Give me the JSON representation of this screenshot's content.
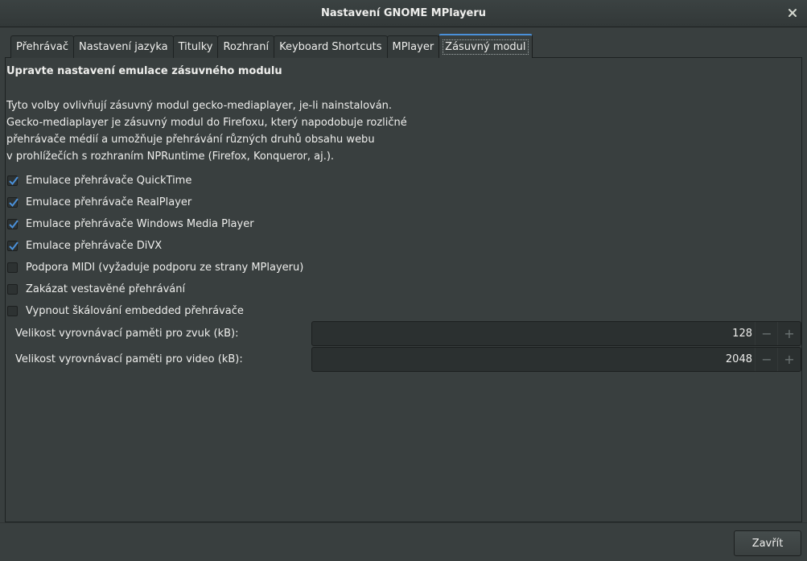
{
  "window": {
    "title": "Nastavení GNOME MPlayeru"
  },
  "tabs": [
    {
      "label": "Přehrávač"
    },
    {
      "label": "Nastavení jazyka"
    },
    {
      "label": "Titulky"
    },
    {
      "label": "Rozhraní"
    },
    {
      "label": "Keyboard Shortcuts"
    },
    {
      "label": "MPlayer"
    },
    {
      "label": "Zásuvný modul",
      "active": true
    }
  ],
  "panel": {
    "heading": "Upravte nastavení emulace zásuvného modulu",
    "description": "Tyto volby ovlivňují zásuvný modul gecko-mediaplayer, je-li nainstalován.\nGecko-mediaplayer je zásuvný modul do Firefoxu, který napodobuje rozličné\npřehrávače médií a umožňuje přehrávání různých druhů obsahu webu\nv prohlížečích s rozhraním NPRuntime (Firefox, Konqueror, aj.).",
    "checkboxes": [
      {
        "label": "Emulace přehrávače QuickTime",
        "checked": true
      },
      {
        "label": "Emulace přehrávače RealPlayer",
        "checked": true
      },
      {
        "label": "Emulace přehrávače Windows Media Player",
        "checked": true
      },
      {
        "label": "Emulace přehrávače DiVX",
        "checked": true
      },
      {
        "label": "Podpora MIDI (vyžaduje podporu ze strany MPlayeru)",
        "checked": false
      },
      {
        "label": "Zakázat vestavěné přehrávání",
        "checked": false
      },
      {
        "label": "Vypnout škálování embedded přehrávače",
        "checked": false
      }
    ],
    "spinners": [
      {
        "label": "Velikost vyrovnávací paměti pro zvuk (kB):",
        "value": "128"
      },
      {
        "label": "Velikost vyrovnávací paměti pro video (kB):",
        "value": "2048"
      }
    ],
    "spin_minus": "−",
    "spin_plus": "+"
  },
  "footer": {
    "close_label": "Zavřít"
  },
  "colors": {
    "accent": "#4a90d9",
    "background": "#393f3f",
    "text": "#eeeeec"
  },
  "icons": {
    "close": "close-icon",
    "check": "check-icon"
  }
}
